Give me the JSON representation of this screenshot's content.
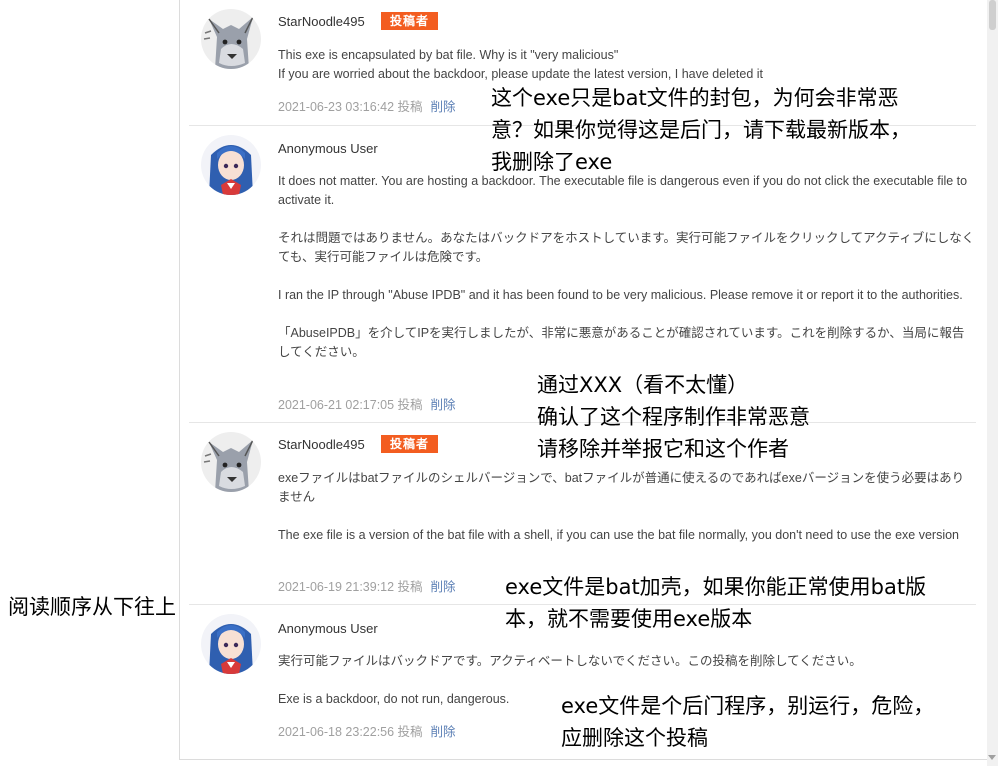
{
  "comments": [
    {
      "author": "StarNoodle495",
      "badge": "投稿者",
      "paragraphs": [
        "This exe is encapsulated by bat file. Why is it \"very malicious\"\nIf you are worried about the backdoor, please update the latest version, I have deleted it"
      ],
      "timestamp": "2021-06-23 03:16:42 投稿",
      "delete_label": "削除"
    },
    {
      "author": "Anonymous User",
      "badge": "",
      "paragraphs": [
        "It does not matter. You are hosting a backdoor. The executable file is dangerous even if you do not click the executable file to activate it.",
        "それは問題ではありません。あなたはバックドアをホストしています。実行可能ファイルをクリックしてアクティブにしなくても、実行可能ファイルは危険です。",
        "I ran the IP through \"Abuse IPDB\" and it has been found to be very malicious. Please remove it or report it to the authorities.",
        "「AbuseIPDB」を介してIPを実行しましたが、非常に悪意があることが確認されています。これを削除するか、当局に報告してください。"
      ],
      "timestamp": "2021-06-21 02:17:05 投稿",
      "delete_label": "削除"
    },
    {
      "author": "StarNoodle495",
      "badge": "投稿者",
      "paragraphs": [
        "exeファイルはbatファイルのシェルバージョンで、batファイルが普通に使えるのであればexeバージョンを使う必要はありません",
        "The exe file is a version of the bat file with a shell, if you can use the bat file normally, you don't need to use the exe version"
      ],
      "timestamp": "2021-06-19 21:39:12 投稿",
      "delete_label": "削除"
    },
    {
      "author": "Anonymous User",
      "badge": "",
      "paragraphs": [
        "実行可能ファイルはバックドアです。アクティベートしないでください。この投稿を削除してください。",
        "Exe is a backdoor, do not run, dangerous."
      ],
      "timestamp": "2021-06-18 23:22:56 投稿",
      "delete_label": "削除"
    }
  ],
  "annotations": [
    [
      "这个exe只是bat文件的封包，为何会非常恶",
      "意？如果你觉得这是后门，请下载最新版本，",
      "我删除了exe"
    ],
    [
      "通过XXX（看不太懂）",
      "确认了这个程序制作非常恶意",
      "请移除并举报它和这个作者"
    ],
    [
      "exe文件是bat加壳，如果你能正常使用bat版",
      "本，就不需要使用exe版本"
    ],
    [
      "阅读顺序从下往上"
    ],
    [
      "exe文件是个后门程序，别运行，危险，",
      "应删除这个投稿"
    ]
  ],
  "colors": {
    "badge": "#f35d20",
    "delete_link": "#5b7fb5",
    "timestamp": "#a0a0a0",
    "body_text": "#444444"
  },
  "icons": {
    "wolf_avatar": "wolf-avatar-icon",
    "anime_avatar": "anime-girl-avatar-icon"
  }
}
